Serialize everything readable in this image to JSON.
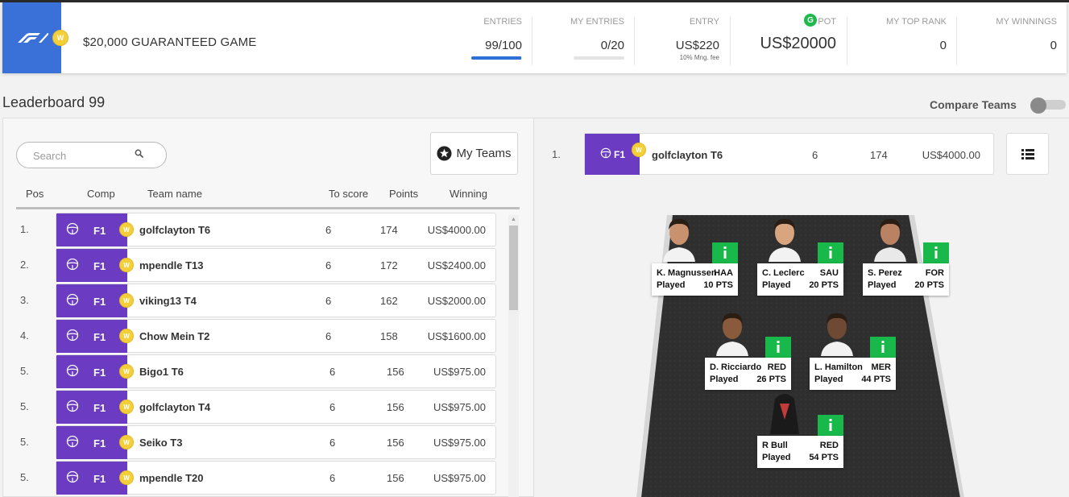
{
  "header": {
    "game_title": "$20,000 GUARANTEED GAME",
    "logo": "F1",
    "coin": "W",
    "stats": {
      "entries_label": "ENTRIES",
      "entries_value": "99/100",
      "entries_progress": 0.99,
      "my_entries_label": "MY ENTRIES",
      "my_entries_value": "0/20",
      "my_entries_progress": 0,
      "entry_label": "ENTRY",
      "entry_value": "US$220",
      "entry_sub": "10% Mng. fee",
      "pot_badge": "G",
      "pot_label": "POT",
      "pot_value": "US$20000",
      "top_rank_label": "MY TOP RANK",
      "top_rank_value": "0",
      "winnings_label": "MY WINNINGS",
      "winnings_value": "0"
    }
  },
  "leaderboard": {
    "title": "Leaderboard 99",
    "compare_label": "Compare Teams",
    "search_placeholder": "Search",
    "my_teams_label": "My Teams",
    "columns": {
      "pos": "Pos",
      "comp": "Comp",
      "team": "Team name",
      "to_score": "To score",
      "points": "Points",
      "winning": "Winning"
    },
    "rows": [
      {
        "pos": "1.",
        "comp": "F1",
        "team": "golfclayton T6",
        "to_score": "6",
        "points": "174",
        "winning": "US$4000.00"
      },
      {
        "pos": "2.",
        "comp": "F1",
        "team": "mpendle T13",
        "to_score": "6",
        "points": "172",
        "winning": "US$2400.00"
      },
      {
        "pos": "3.",
        "comp": "F1",
        "team": "viking13 T4",
        "to_score": "6",
        "points": "162",
        "winning": "US$2000.00"
      },
      {
        "pos": "4.",
        "comp": "F1",
        "team": "Chow Mein T2",
        "to_score": "6",
        "points": "158",
        "winning": "US$1600.00"
      },
      {
        "pos": "5.",
        "comp": "F1",
        "team": "Bigo1 T6",
        "to_score": "6",
        "points": "156",
        "winning": "US$975.00"
      },
      {
        "pos": "5.",
        "comp": "F1",
        "team": "golfclayton T4",
        "to_score": "6",
        "points": "156",
        "winning": "US$975.00"
      },
      {
        "pos": "5.",
        "comp": "F1",
        "team": "Seiko T3",
        "to_score": "6",
        "points": "156",
        "winning": "US$975.00"
      },
      {
        "pos": "5.",
        "comp": "F1",
        "team": "mpendle T20",
        "to_score": "6",
        "points": "156",
        "winning": "US$975.00"
      }
    ]
  },
  "selected": {
    "pos": "1.",
    "comp": "F1",
    "team": "golfclayton T6",
    "to_score": "6",
    "points": "174",
    "winning": "US$4000.00",
    "drivers": [
      {
        "name": "K. Magnussen",
        "team": "HAA",
        "status": "Played",
        "score": "10 PTS"
      },
      {
        "name": "C. Leclerc",
        "team": "SAU",
        "status": "Played",
        "score": "20 PTS"
      },
      {
        "name": "S. Perez",
        "team": "FOR",
        "status": "Played",
        "score": "20 PTS"
      },
      {
        "name": "D. Ricciardo",
        "team": "RED",
        "status": "Played",
        "score": "26 PTS"
      },
      {
        "name": "L. Hamilton",
        "team": "MER",
        "status": "Played",
        "score": "44 PTS"
      },
      {
        "name": "R Bull",
        "team": "RED",
        "status": "Played",
        "score": "54 PTS"
      }
    ]
  },
  "colors": {
    "accent_blue": "#3a71d9",
    "comp_purple": "#6b3cc1",
    "coin_yellow": "#f3cf3a",
    "info_green": "#19b84a"
  }
}
